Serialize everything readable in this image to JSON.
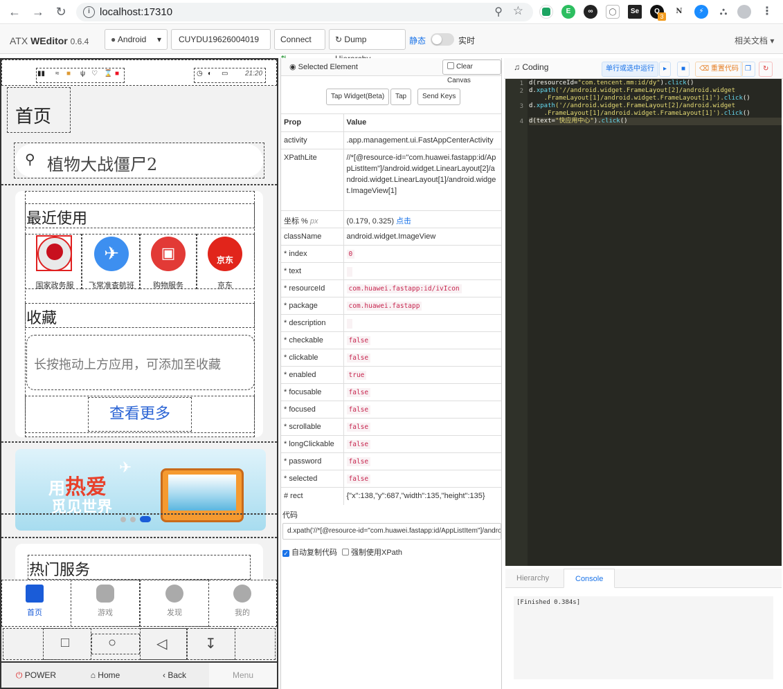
{
  "browser": {
    "url": "localhost:17310",
    "ext_badge": "3"
  },
  "header": {
    "brand_name": "ATX",
    "brand_product": "WEditor",
    "version": "0.6.4",
    "platform": "Android",
    "serial": "CUYDU19626004019",
    "connect_label": "Connect",
    "dump_label": "Dump Hierarchy",
    "static_label": "静态",
    "realtime_label": "实时",
    "docs_label": "相关文档"
  },
  "device": {
    "status_time": "21:20",
    "home_title": "首页",
    "search_text": "植物大战僵尸2",
    "recent_title": "最近使用",
    "recent_apps": [
      {
        "label": "国家政务服",
        "color": "#e8e8e8"
      },
      {
        "label": "飞常准查航班",
        "color": "#3d8ff0"
      },
      {
        "label": "购物服务",
        "color": "#e23a36"
      },
      {
        "label": "京东",
        "color": "#e1251b"
      }
    ],
    "jd_text": "京东",
    "fav_title": "收藏",
    "fav_hint": "长按拖动上方应用，可添加至收藏",
    "more_label": "查看更多",
    "banner_line1_a": "用",
    "banner_line1_b": "热爱",
    "banner_line2": "觅见世界",
    "hot_title": "热门服务",
    "tabs": [
      {
        "label": "首页",
        "active": true
      },
      {
        "label": "游戏",
        "active": false
      },
      {
        "label": "发现",
        "active": false
      },
      {
        "label": "我的",
        "active": false
      }
    ],
    "buttons": {
      "power": "POWER",
      "home": "Home",
      "back": "Back",
      "menu": "Menu"
    }
  },
  "inspector": {
    "title": "Selected Element",
    "clear_canvas": "Clear Canvas",
    "tap_widget": "Tap Widget(Beta)",
    "tap": "Tap",
    "send_keys": "Send Keys",
    "col_prop": "Prop",
    "col_value": "Value",
    "rows": {
      "activity_k": "activity",
      "activity_v": ".app.management.ui.FastAppCenterActivity",
      "xpath_k": "XPathLite",
      "xpath_v": "//*[@resource-id=\"com.huawei.fastapp:id/AppListItem\"]/android.widget.LinearLayout[2]/android.widget.LinearLayout[1]/android.widget.ImageView[1]",
      "coord_k": "坐标 %",
      "coord_unit": "px",
      "coord_v": "(0.179, 0.325)",
      "coord_link": "点击",
      "classname_k": "className",
      "classname_v": "android.widget.ImageView",
      "index_k": "* index",
      "index_v": "0",
      "text_k": "* text",
      "resourceid_k": "* resourceId",
      "resourceid_v": "com.huawei.fastapp:id/ivIcon",
      "package_k": "* package",
      "package_v": "com.huawei.fastapp",
      "description_k": "* description",
      "checkable_k": "* checkable",
      "checkable_v": "false",
      "clickable_k": "* clickable",
      "clickable_v": "false",
      "enabled_k": "* enabled",
      "enabled_v": "true",
      "focusable_k": "* focusable",
      "focusable_v": "false",
      "focused_k": "* focused",
      "focused_v": "false",
      "scrollable_k": "* scrollable",
      "scrollable_v": "false",
      "longclickable_k": "* longClickable",
      "longclickable_v": "false",
      "password_k": "* password",
      "password_v": "false",
      "selected_k": "* selected",
      "selected_v": "false",
      "rect_k": "# rect",
      "rect_v": "{\"x\":138,\"y\":687,\"width\":135,\"height\":135}"
    },
    "code_label": "代码",
    "code_value": "d.xpath('//*[@resource-id=\"com.huawei.fastapp:id/AppListItem\"]/andro",
    "auto_copy": "自动复制代码",
    "force_xpath": "强制使用XPath"
  },
  "coding": {
    "title": "Coding",
    "run_selected": "单行或选中运行",
    "reset_code": "重置代码",
    "lines": [
      {
        "n": "1",
        "a": "d(resourceId=",
        "s": "\"com.tencent.mm:id/dy\"",
        "b": ").",
        "f": "click",
        "c": "()"
      },
      {
        "n": "",
        "a": "d.",
        "s": "",
        "b": "",
        "f": "xpath",
        "c": "('//android.widget.FrameLayout[2]/android.widget"
      },
      {
        "n": "",
        "a": "    .FrameLayout[1]/android.widget.FrameLayout[1]').",
        "s": "",
        "b": "",
        "f": "click",
        "c": "()"
      },
      {
        "n": "3",
        "a": "d.",
        "s": "",
        "b": "",
        "f": "xpath",
        "c": "('//android.widget.FrameLayout[2]/android.widget"
      },
      {
        "n": "",
        "a": "    .FrameLayout[1]/android.widget.FrameLayout[1]').",
        "s": "",
        "b": "",
        "f": "click",
        "c": "()"
      },
      {
        "n": "4",
        "a": "d(text=",
        "s": "\"快应用中心\"",
        "b": ").",
        "f": "click",
        "c": "()"
      }
    ],
    "line2_num": "2",
    "tab_hierarchy": "Hierarchy",
    "tab_console": "Console",
    "console_text": "[Finished 0.384s]"
  }
}
